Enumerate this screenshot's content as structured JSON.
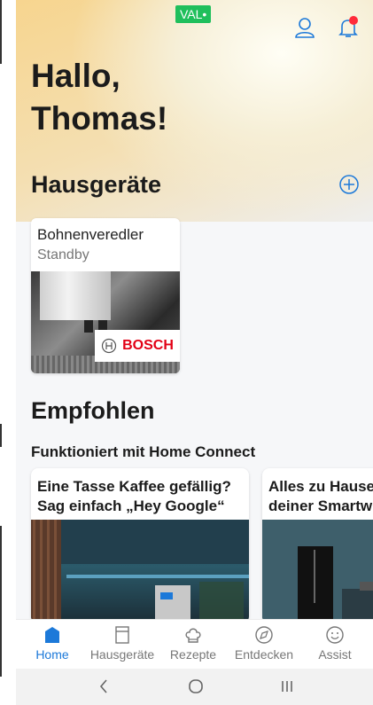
{
  "status": {
    "badge": "VAL•"
  },
  "greeting": {
    "line1": "Hallo,",
    "line2": "Thomas!"
  },
  "appliances": {
    "title": "Hausgeräte",
    "items": [
      {
        "name": "Bohnenveredler",
        "status": "Standby",
        "brand": "BOSCH"
      }
    ]
  },
  "recommended": {
    "title": "Empfohlen",
    "subtitle": "Funktioniert mit Home Connect",
    "cards": [
      {
        "title_line1": "Eine Tasse Kaffee gefällig?",
        "title_line2": "Sag einfach „Hey Google“"
      },
      {
        "title_line1": "Alles zu Hause",
        "title_line2": "deiner Smartw"
      }
    ]
  },
  "tabs": [
    {
      "label": "Home",
      "icon": "home-icon",
      "active": true
    },
    {
      "label": "Hausgeräte",
      "icon": "appliance-icon",
      "active": false
    },
    {
      "label": "Rezepte",
      "icon": "chef-hat-icon",
      "active": false
    },
    {
      "label": "Entdecken",
      "icon": "compass-icon",
      "active": false
    },
    {
      "label": "Assist",
      "icon": "smiley-icon",
      "active": false
    }
  ],
  "colors": {
    "accent": "#1c79d9",
    "notification": "#ff2b3a",
    "bosch_red": "#e20015",
    "badge_green": "#1fbf5c"
  }
}
